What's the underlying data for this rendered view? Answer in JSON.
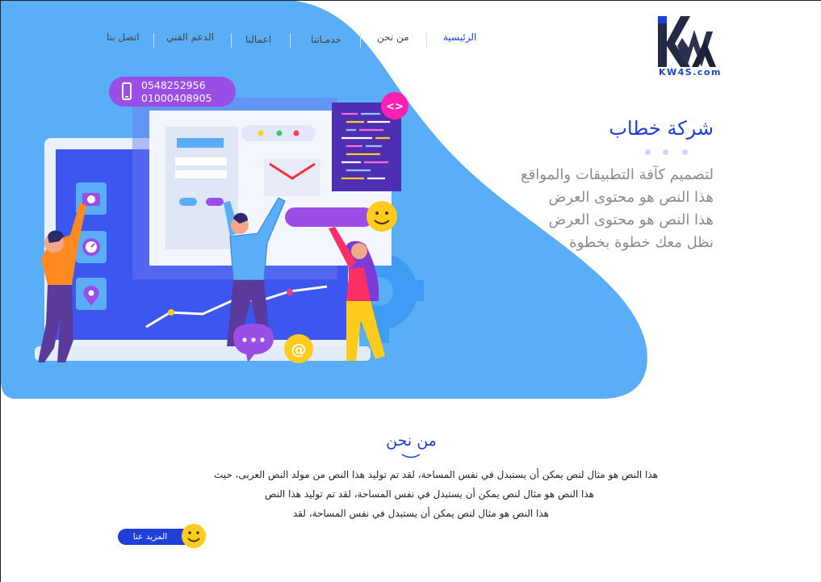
{
  "brand": {
    "logo_text": "KW4S.com"
  },
  "nav": {
    "items": [
      {
        "label": "الرئيسية",
        "active": true
      },
      {
        "label": "من نحن",
        "active": false
      },
      {
        "label": "خدمـاتنا",
        "active": false
      },
      {
        "label": "اعمالنا",
        "active": false
      },
      {
        "label": "الدعم الفني",
        "active": false
      },
      {
        "label": "اتصل بنا",
        "active": false
      }
    ]
  },
  "contact": {
    "phones": [
      "0548252956",
      "01000408905"
    ]
  },
  "hero": {
    "title": "شركة خطاب",
    "lines": [
      "لتصميم كآفة التطبيقات والمواقع",
      "هذا النص هو محتوى العرض",
      "هذا النص هو محتوى العرض",
      "نظل معك خطوة بخطوة"
    ]
  },
  "about": {
    "title": "من نحن",
    "paragraph_lines": [
      "هذا النص هو مثال لنص يمكن أن يستبدل في نفس المساحة، لقد تم توليد هذا النص من مولد النص العربى، حيث",
      "هذا النص هو مثال لنص يمكن أن يستبدل في نفس المساحة، لقد تم توليد هذا النص",
      "هذا النص هو مثال لنص يمكن أن يستبدل في نفس المساحة، لقد"
    ],
    "more_label": "المزيد عنا"
  },
  "colors": {
    "primary": "#1e40d8",
    "hero_blue": "#5aaef8",
    "purple": "#9b4ee6",
    "yellow": "#ffcc1d",
    "pink": "#ff1fb0"
  },
  "icons": [
    "phone-icon",
    "camera-icon",
    "clock-icon",
    "location-icon",
    "mail-icon",
    "code-icon",
    "smile-icon",
    "chat-icon",
    "at-icon",
    "gear-icon"
  ]
}
